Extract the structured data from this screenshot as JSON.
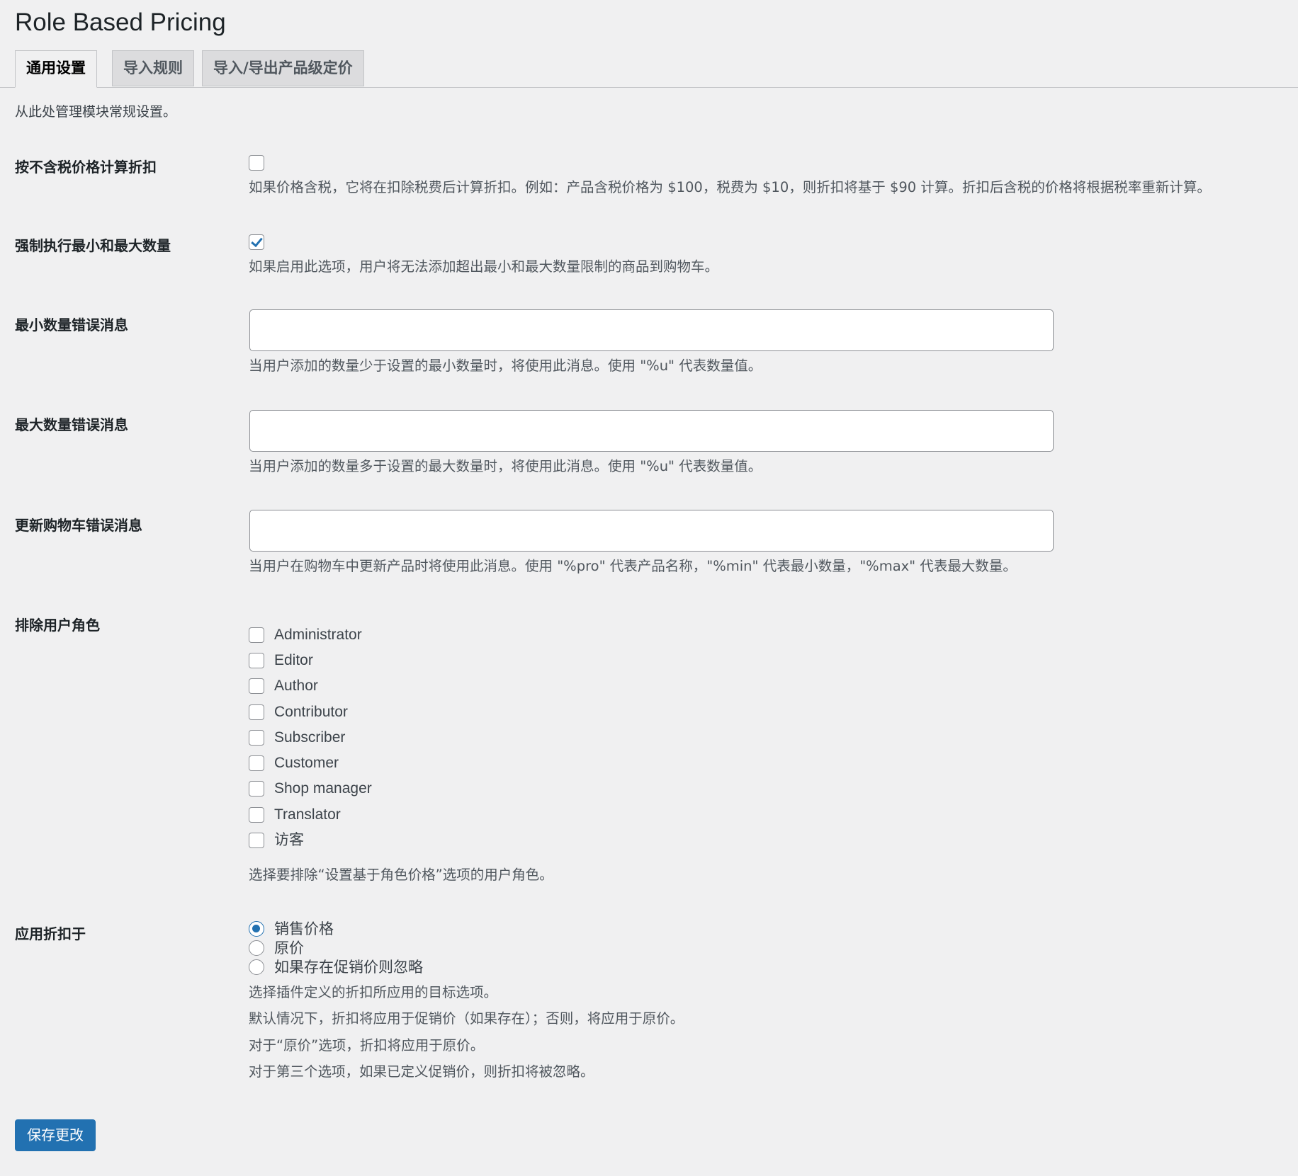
{
  "page": {
    "title": "Role Based Pricing",
    "intro": "从此处管理模块常规设置。"
  },
  "tabs": [
    {
      "label": "通用设置",
      "active": true
    },
    {
      "label": "导入规则",
      "active": false
    },
    {
      "label": "导入/导出产品级定价",
      "active": false
    }
  ],
  "settings": {
    "exclude_tax": {
      "label": "按不含税价格计算折扣",
      "checked": false,
      "description": "如果价格含税，它将在扣除税费后计算折扣。例如：产品含税价格为 $100，税费为 $10，则折扣将基于 $90 计算。折扣后含税的价格将根据税率重新计算。"
    },
    "enforce_qty": {
      "label": "强制执行最小和最大数量",
      "checked": true,
      "description": "如果启用此选项，用户将无法添加超出最小和最大数量限制的商品到购物车。"
    },
    "min_qty_msg": {
      "label": "最小数量错误消息",
      "value": "",
      "description": "当用户添加的数量少于设置的最小数量时，将使用此消息。使用 \"%u\" 代表数量值。"
    },
    "max_qty_msg": {
      "label": "最大数量错误消息",
      "value": "",
      "description": "当用户添加的数量多于设置的最大数量时，将使用此消息。使用 \"%u\" 代表数量值。"
    },
    "update_cart_msg": {
      "label": "更新购物车错误消息",
      "value": "",
      "description": "当用户在购物车中更新产品时将使用此消息。使用 \"%pro\" 代表产品名称，\"%min\" 代表最小数量，\"%max\" 代表最大数量。"
    },
    "exclude_roles": {
      "label": "排除用户角色",
      "roles": [
        {
          "label": "Administrator",
          "checked": false
        },
        {
          "label": "Editor",
          "checked": false
        },
        {
          "label": "Author",
          "checked": false
        },
        {
          "label": "Contributor",
          "checked": false
        },
        {
          "label": "Subscriber",
          "checked": false
        },
        {
          "label": "Customer",
          "checked": false
        },
        {
          "label": "Shop manager",
          "checked": false
        },
        {
          "label": "Translator",
          "checked": false
        },
        {
          "label": "访客",
          "checked": false
        }
      ],
      "description": "选择要排除“设置基于角色价格”选项的用户角色。"
    },
    "apply_discount": {
      "label": "应用折扣于",
      "options": [
        {
          "label": "销售价格",
          "checked": true
        },
        {
          "label": "原价",
          "checked": false
        },
        {
          "label": "如果存在促销价则忽略",
          "checked": false
        }
      ],
      "descriptions": [
        "选择插件定义的折扣所应用的目标选项。",
        "默认情况下，折扣将应用于促销价（如果存在）；否则，将应用于原价。",
        "对于“原价”选项，折扣将应用于原价。",
        "对于第三个选项，如果已定义促销价，则折扣将被忽略。"
      ]
    }
  },
  "actions": {
    "save_label": "保存更改"
  },
  "colors": {
    "accent": "#2271b1",
    "background": "#f0f0f1"
  }
}
